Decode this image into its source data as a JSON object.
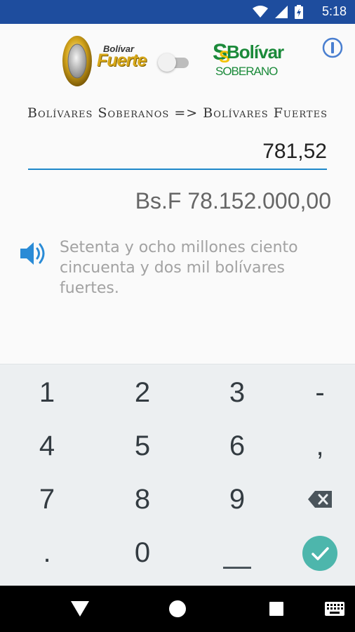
{
  "status_bar": {
    "time": "5:18"
  },
  "header": {
    "left_logo_line1": "Bolívar",
    "left_logo_line2": "Fuerte",
    "right_logo_line1": "Bolívar",
    "right_logo_line2": "SOBERANO",
    "toggle_on": false
  },
  "conversion": {
    "direction_label": "Bolívares Soberanos => Bolívares Fuertes",
    "input_value": "781,52",
    "result": "Bs.F 78.152.000,00",
    "words": "Setenta y ocho millones ciento cincuenta y dos mil bolívares fuertes."
  },
  "keypad": {
    "k1": "1",
    "k2": "2",
    "k3": "3",
    "minus": "-",
    "k4": "4",
    "k5": "5",
    "k6": "6",
    "comma": ",",
    "k7": "7",
    "k8": "8",
    "k9": "9",
    "dot": ".",
    "k0": "0"
  },
  "colors": {
    "status_bar": "#1e4d9e",
    "accent": "#1e88c9",
    "done": "#4db6ac",
    "logo_green": "#1b8a3a",
    "logo_gold": "#d7a81a"
  }
}
